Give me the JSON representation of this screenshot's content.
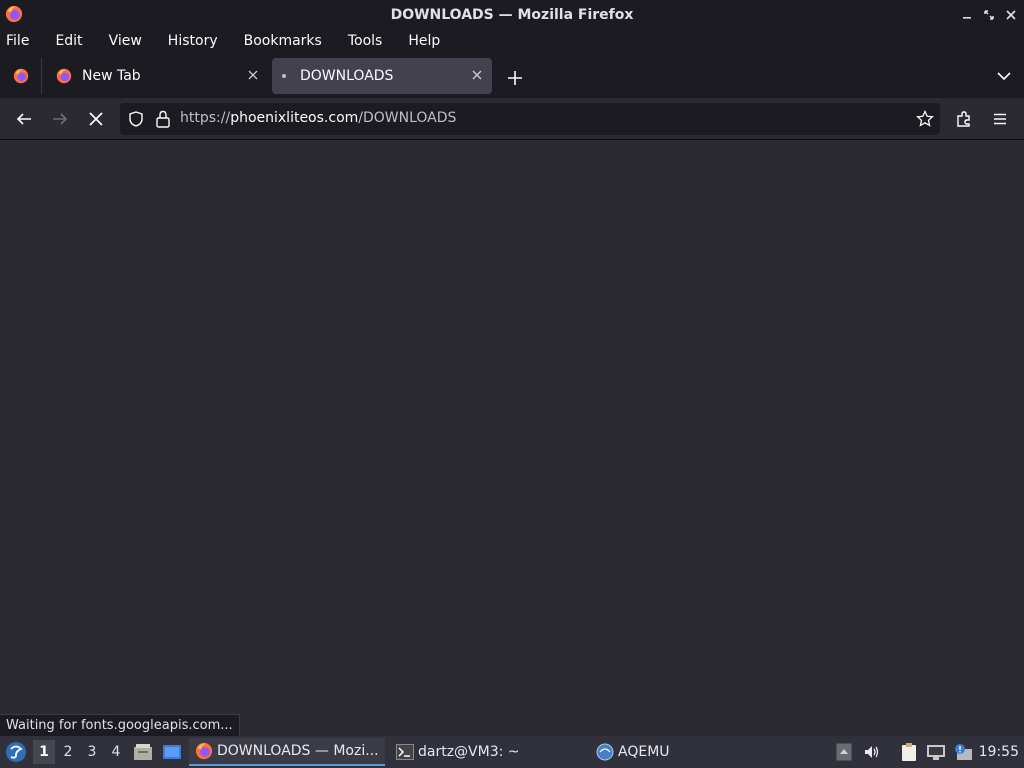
{
  "window": {
    "title": "DOWNLOADS — Mozilla Firefox",
    "buttons": [
      "minimize",
      "restore",
      "close"
    ]
  },
  "menubar": {
    "items": [
      {
        "label": "File",
        "accel": "F"
      },
      {
        "label": "Edit",
        "accel": "E"
      },
      {
        "label": "View",
        "accel": "V"
      },
      {
        "label": "History",
        "accel": "s"
      },
      {
        "label": "Bookmarks",
        "accel": "B"
      },
      {
        "label": "Tools",
        "accel": "T"
      },
      {
        "label": "Help",
        "accel": "H"
      }
    ]
  },
  "tabs": [
    {
      "label": "New Tab",
      "icon": "firefox-icon",
      "active": false
    },
    {
      "label": "DOWNLOADS",
      "icon": "loading-dot",
      "active": true
    }
  ],
  "navbar": {
    "url_scheme": "https://",
    "url_host": "phoenixliteos.com",
    "url_path": "/DOWNLOADS",
    "reload_state": "stop"
  },
  "status": {
    "text": "Waiting for fonts.googleapis.com..."
  },
  "taskbar": {
    "workspaces": [
      "1",
      "2",
      "3",
      "4"
    ],
    "active_workspace": "1",
    "tasks": [
      {
        "label": "DOWNLOADS — Mozi...",
        "icon": "firefox-icon",
        "active": true
      },
      {
        "label": "dartz@VM3: ~",
        "icon": "terminal-icon",
        "active": false
      },
      {
        "label": "AQEMU",
        "icon": "aqemu-icon",
        "active": false
      }
    ],
    "clock": "19:55"
  },
  "colors": {
    "chrome_dark": "#1c1b22",
    "content_bg": "#2b2a33",
    "active_tab": "#42414d",
    "taskbar": "#30313a",
    "accent": "#5b9bd5"
  }
}
